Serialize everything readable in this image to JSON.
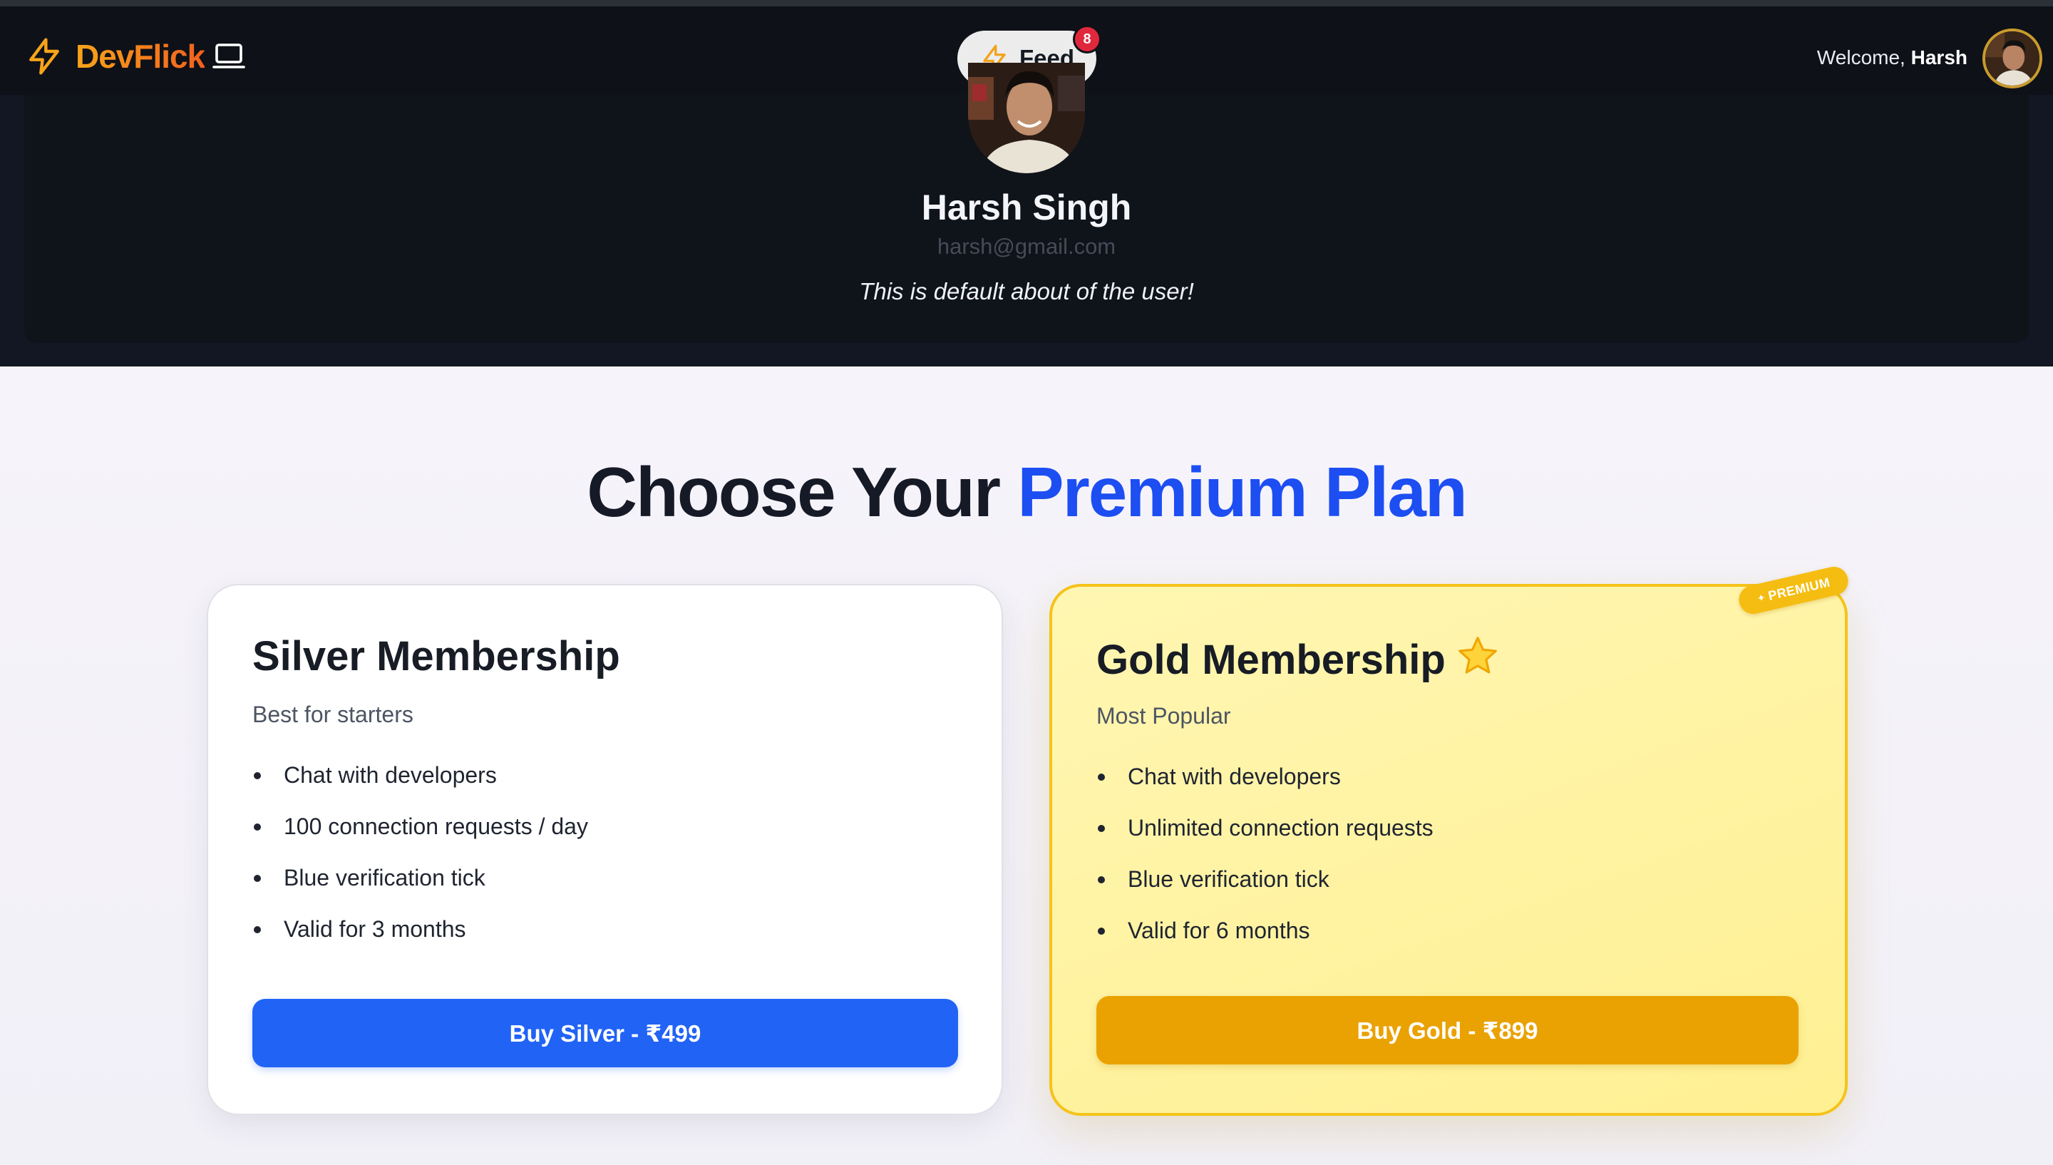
{
  "navbar": {
    "brand_name": "DevFlick",
    "feed_label": "Feed",
    "feed_badge_count": "8",
    "welcome_prefix": "Welcome,",
    "welcome_user": "Harsh"
  },
  "profile": {
    "name": "Harsh Singh",
    "email": "harsh@gmail.com",
    "about": "This is default about of the user!"
  },
  "plans": {
    "heading_prefix": "Choose Your",
    "heading_accent": "Premium Plan",
    "silver": {
      "title": "Silver Membership",
      "subtitle": "Best for starters",
      "features": [
        "Chat with developers",
        "100 connection requests / day",
        "Blue verification tick",
        "Valid for 3 months"
      ],
      "button_label": "Buy Silver - ₹499"
    },
    "gold": {
      "title": "Gold Membership",
      "subtitle": "Most Popular",
      "ribbon_label": "PREMIUM",
      "features": [
        "Chat with developers",
        "Unlimited connection requests",
        "Blue verification tick",
        "Valid for 6 months"
      ],
      "button_label": "Buy Gold - ₹899"
    }
  },
  "colors": {
    "navbar_bg": "#0e1117",
    "profile_bg": "#121723",
    "brand_gradient_start": "#f7a31a",
    "brand_gradient_end": "#f2611e",
    "accent_blue": "#1d4ef2",
    "silver_button": "#2163f5",
    "gold_button": "#e9a201",
    "gold_border": "#f5c31a",
    "badge_red": "#e0283c"
  },
  "icons": {
    "brand_icon": "lightning-bolt",
    "brand_suffix_icon": "laptop",
    "feed_icon": "lightning-bolt",
    "gold_title_icon": "star",
    "ribbon_icon": "sparkle-star"
  }
}
